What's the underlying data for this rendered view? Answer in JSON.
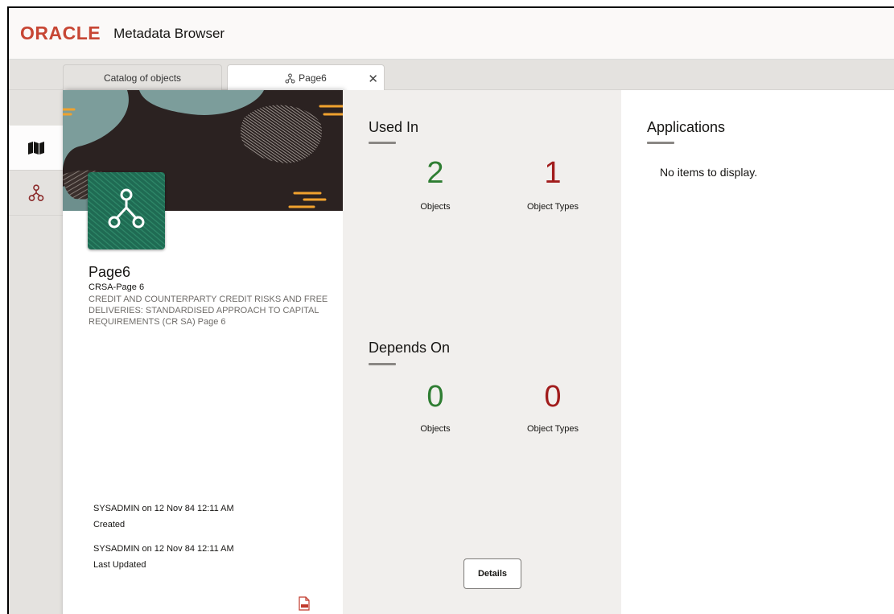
{
  "header": {
    "logo": "ORACLE",
    "title": "Metadata Browser"
  },
  "tabs": [
    {
      "label": "Catalog of objects",
      "active": false
    },
    {
      "label": "Page6",
      "active": true,
      "icon": "hierarchy-icon",
      "closable": true
    }
  ],
  "rail": [
    {
      "icon": "map-icon",
      "selected": true
    },
    {
      "icon": "hierarchy-icon",
      "selected": false
    }
  ],
  "card": {
    "title": "Page6",
    "subtitle": "CRSA-Page 6",
    "description": "CREDIT AND COUNTERPARTY CREDIT RISKS AND FREE DELIVERIES: STANDARDISED APPROACH TO CAPITAL REQUIREMENTS (CR SA) Page 6",
    "created_value": "SYSADMIN on 12 Nov 84 12:11 AM",
    "created_label": "Created",
    "updated_value": "SYSADMIN on 12 Nov 84 12:11 AM",
    "updated_label": "Last Updated",
    "export_icon": "pdf-icon"
  },
  "used_in": {
    "title": "Used In",
    "objects_count": "2",
    "objects_label": "Objects",
    "types_count": "1",
    "types_label": "Object Types"
  },
  "depends_on": {
    "title": "Depends On",
    "objects_count": "0",
    "objects_label": "Objects",
    "types_count": "0",
    "types_label": "Object Types"
  },
  "details_button": "Details",
  "applications": {
    "title": "Applications",
    "empty_text": "No items to display."
  },
  "colors": {
    "brand": "#c74634",
    "count_green": "#2e7d32",
    "count_red": "#a11c1c"
  }
}
